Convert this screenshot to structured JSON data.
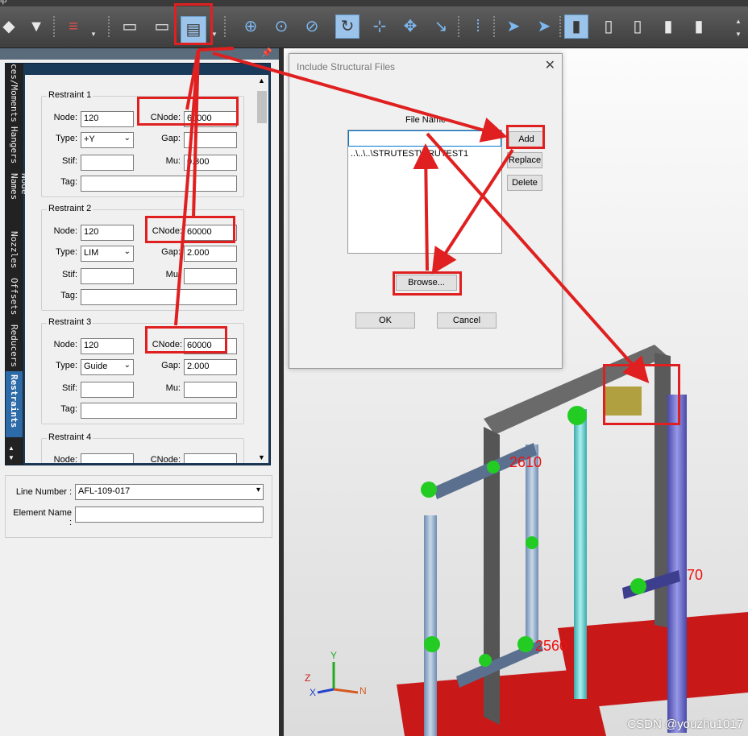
{
  "menu": {
    "partial_text": "lp"
  },
  "toolbar": {
    "include_structural_icon": "structural-file-icon"
  },
  "panel": {
    "pin": "📌",
    "chevron": "»",
    "vtabs": [
      "ces/Moments",
      "Hangers",
      "Node Names",
      "Nozzles",
      "Offsets",
      "Reducers",
      "Restraints"
    ],
    "labels": {
      "node": "Node:",
      "cnode": "CNode:",
      "type": "Type:",
      "gap": "Gap:",
      "stif": "Stif:",
      "mu": "Mu:",
      "tag": "Tag:"
    },
    "restraints": [
      {
        "title": "Restraint 1",
        "node": "120",
        "cnode": "60000",
        "type": "+Y",
        "gap": "",
        "stif": "",
        "mu": "0.300",
        "tag": ""
      },
      {
        "title": "Restraint 2",
        "node": "120",
        "cnode": "60000",
        "type": "LIM",
        "gap": "2.000",
        "stif": "",
        "mu": "",
        "tag": ""
      },
      {
        "title": "Restraint 3",
        "node": "120",
        "cnode": "60000",
        "type": "Guide",
        "gap": "2.000",
        "stif": "",
        "mu": "",
        "tag": ""
      },
      {
        "title": "Restraint 4",
        "node": "",
        "cnode": ""
      }
    ],
    "line_number_label": "Line Number :",
    "line_number_value": "AFL-109-017",
    "element_name_label": "Element Name :",
    "element_name_value": ""
  },
  "dialog": {
    "title": "Include Structural Files",
    "column_header": "File Name",
    "files": [
      "..\\..\\..\\STRUTEST\\SRUTEST1"
    ],
    "buttons": {
      "add": "Add",
      "replace": "Replace",
      "delete": "Delete",
      "browse": "Browse...",
      "ok": "OK",
      "cancel": "Cancel"
    }
  },
  "viewport": {
    "labels": [
      "2610",
      "70",
      "2560"
    ],
    "axes": {
      "y": "Y",
      "z": "Z",
      "x": "X",
      "n": "N"
    }
  },
  "watermark": "CSDN @youzhu1017",
  "colors": {
    "highlight": "#e02020",
    "pipe": "#8ea9c8",
    "support": "#cc1111",
    "restraint": "#22cc22"
  }
}
